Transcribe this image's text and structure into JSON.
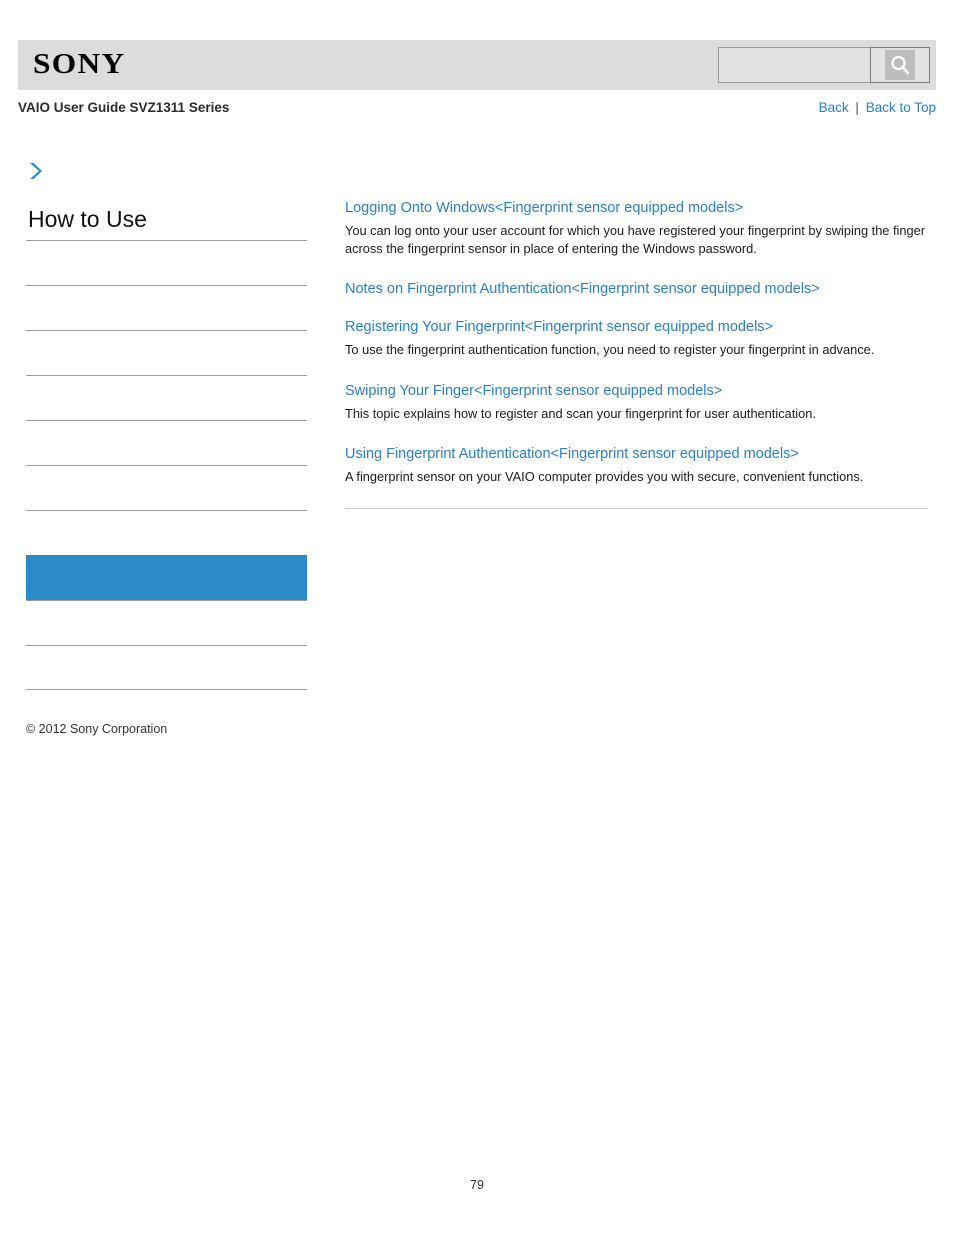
{
  "header": {
    "logo_text": "SONY",
    "search": {
      "value": "",
      "placeholder": "",
      "icon": "search-icon"
    }
  },
  "subheader": {
    "guide_title": "VAIO User Guide SVZ1311 Series",
    "nav": {
      "back_label": "Back",
      "separator": "|",
      "back_to_top_label": "Back to Top"
    }
  },
  "sidebar": {
    "arrow_icon": "chevron-right-icon",
    "title": "How to Use",
    "items": [
      {
        "label": "",
        "active": false
      },
      {
        "label": "",
        "active": false
      },
      {
        "label": "",
        "active": false
      },
      {
        "label": "",
        "active": false
      },
      {
        "label": "",
        "active": false
      },
      {
        "label": "",
        "active": false
      },
      {
        "label": "",
        "active": false
      },
      {
        "label": "",
        "active": true
      },
      {
        "label": "",
        "active": false
      },
      {
        "label": "",
        "active": false
      }
    ],
    "copyright": "© 2012 Sony Corporation"
  },
  "content": {
    "topics": [
      {
        "link": "Logging Onto Windows<Fingerprint sensor equipped models>",
        "desc": "You can log onto your user account for which you have registered your fingerprint by swiping the finger across the fingerprint sensor in place of entering the Windows password."
      },
      {
        "link": "Notes on Fingerprint Authentication<Fingerprint sensor equipped models>",
        "desc": ""
      },
      {
        "link": "Registering Your Fingerprint<Fingerprint sensor equipped models>",
        "desc": "To use the fingerprint authentication function, you need to register your fingerprint in advance."
      },
      {
        "link": "Swiping Your Finger<Fingerprint sensor equipped models>",
        "desc": "This topic explains how to register and scan your fingerprint for user authentication."
      },
      {
        "link": "Using Fingerprint Authentication<Fingerprint sensor equipped models>",
        "desc": "A fingerprint sensor on your VAIO computer provides you with secure, convenient functions."
      }
    ]
  },
  "footer": {
    "page_number": "79"
  },
  "colors": {
    "link": "#2b7ec9",
    "active_item": "#2b8ac9",
    "header_bar": "#dcdcdc"
  }
}
